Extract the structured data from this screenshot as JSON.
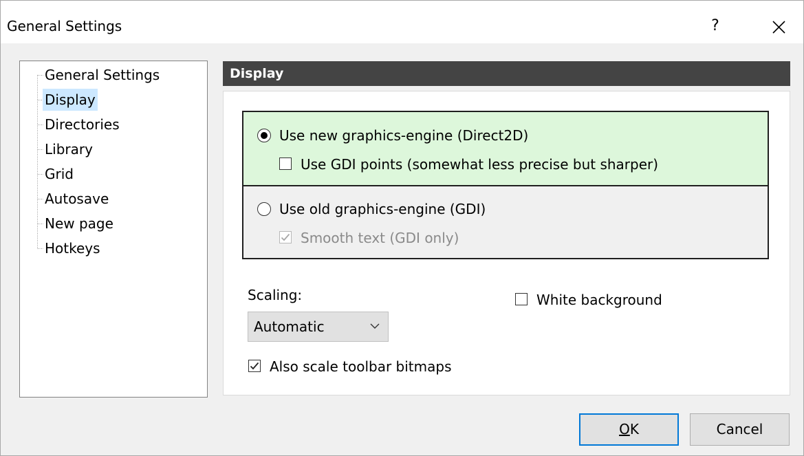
{
  "window": {
    "title": "General Settings",
    "help_glyph": "?",
    "close_icon": "close-icon"
  },
  "tree": {
    "items": [
      {
        "label": "General Settings"
      },
      {
        "label": "Display",
        "selected": true
      },
      {
        "label": "Directories"
      },
      {
        "label": "Library"
      },
      {
        "label": "Grid"
      },
      {
        "label": "Autosave"
      },
      {
        "label": "New page"
      },
      {
        "label": "Hotkeys"
      }
    ]
  },
  "panel": {
    "header": "Display",
    "engine_new": {
      "label": "Use new graphics-engine (Direct2D)",
      "selected": true,
      "background": "#ddf7db",
      "gdi_points": {
        "label": "Use GDI points (somewhat less precise but sharper)",
        "checked": false
      }
    },
    "engine_old": {
      "label": "Use old graphics-engine (GDI)",
      "selected": false,
      "smooth_text": {
        "label": "Smooth text (GDI only)",
        "checked": true,
        "disabled": true
      }
    },
    "scaling": {
      "label": "Scaling:",
      "value": "Automatic"
    },
    "white_background": {
      "label": "White background",
      "checked": false
    },
    "scale_toolbar": {
      "label": "Also scale toolbar bitmaps",
      "checked": true
    }
  },
  "buttons": {
    "ok_mnemonic": "O",
    "ok_rest": "K",
    "cancel": "Cancel"
  },
  "colors": {
    "header_bg": "#444444",
    "selection_bg": "#cce8ff",
    "default_button_border": "#0078d7"
  }
}
